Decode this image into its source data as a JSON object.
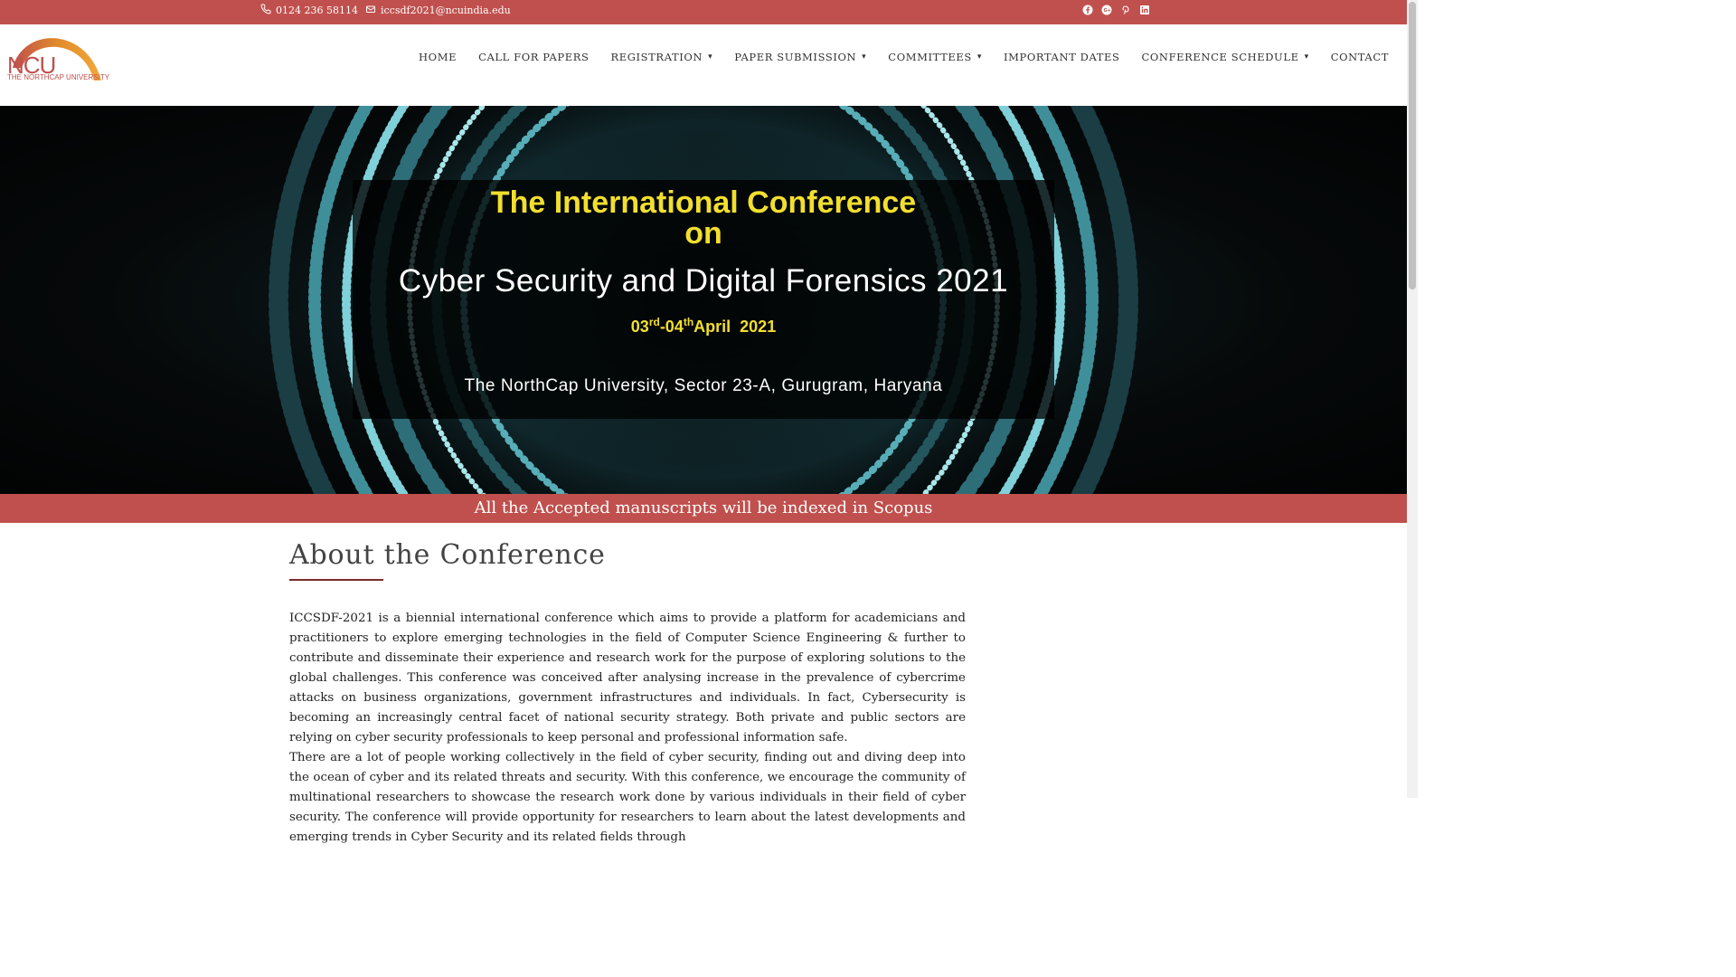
{
  "topbar": {
    "phone": "0124 236 58114",
    "email": "iccsdf2021@ncuindia.edu",
    "social": [
      "facebook-icon",
      "google-plus-icon",
      "pinterest-icon",
      "linkedin-icon"
    ],
    "bg_color": "#c0504d"
  },
  "logo": {
    "abbr": "NCU",
    "name": "THE NORTHCAP UNIVERSITY"
  },
  "nav": {
    "items": [
      {
        "label": "HOME",
        "dropdown": false
      },
      {
        "label": "CALL FOR PAPERS",
        "dropdown": false
      },
      {
        "label": "REGISTRATION",
        "dropdown": true
      },
      {
        "label": "PAPER SUBMISSION",
        "dropdown": true
      },
      {
        "label": "COMMITTEES",
        "dropdown": true
      },
      {
        "label": "IMPORTANT DATES",
        "dropdown": false
      },
      {
        "label": "CONFERENCE SCHEDULE",
        "dropdown": true
      },
      {
        "label": "CONTACT",
        "dropdown": false
      }
    ]
  },
  "hero": {
    "title_line1": "The International Conference",
    "title_line2": "on",
    "title_line3": "Cyber Security and Digital Forensics 2021",
    "date_day1": "03",
    "date_sup1": "rd",
    "date_day2": "-04",
    "date_sup2": "th",
    "date_rest": "April  2021",
    "venue": "The NorthCap University, Sector 23-A, Gurugram, Haryana",
    "accent_color": "#f2df2e"
  },
  "banner": {
    "text": "All the Accepted manuscripts will be indexed in Scopus"
  },
  "about": {
    "heading": "About the Conference",
    "para1": "ICCSDF-2021 is a biennial international conference which aims to provide a platform for academicians and practitioners to explore emerging technologies in the field of Computer Science Engineering & further to contribute and disseminate their experience and research work for the purpose of exploring solutions to the global challenges. This conference was conceived after analysing increase in the prevalence of cybercrime attacks on business organizations, government infrastructures and individuals. In fact, Cybersecurity is becoming an increasingly central facet of national security strategy. Both private and public sectors are relying on cyber security professionals to keep personal and professional information safe.",
    "para2": "There are a lot of people working collectively in the field of cyber security, finding out and diving deep into the ocean of cyber and its related threats and security. With this conference, we encourage the community of multinational researchers to showcase the research work done by various individuals in their field of cyber security. The conference will provide opportunity for researchers to learn about the latest developments and emerging trends in Cyber Security and its related fields through"
  }
}
